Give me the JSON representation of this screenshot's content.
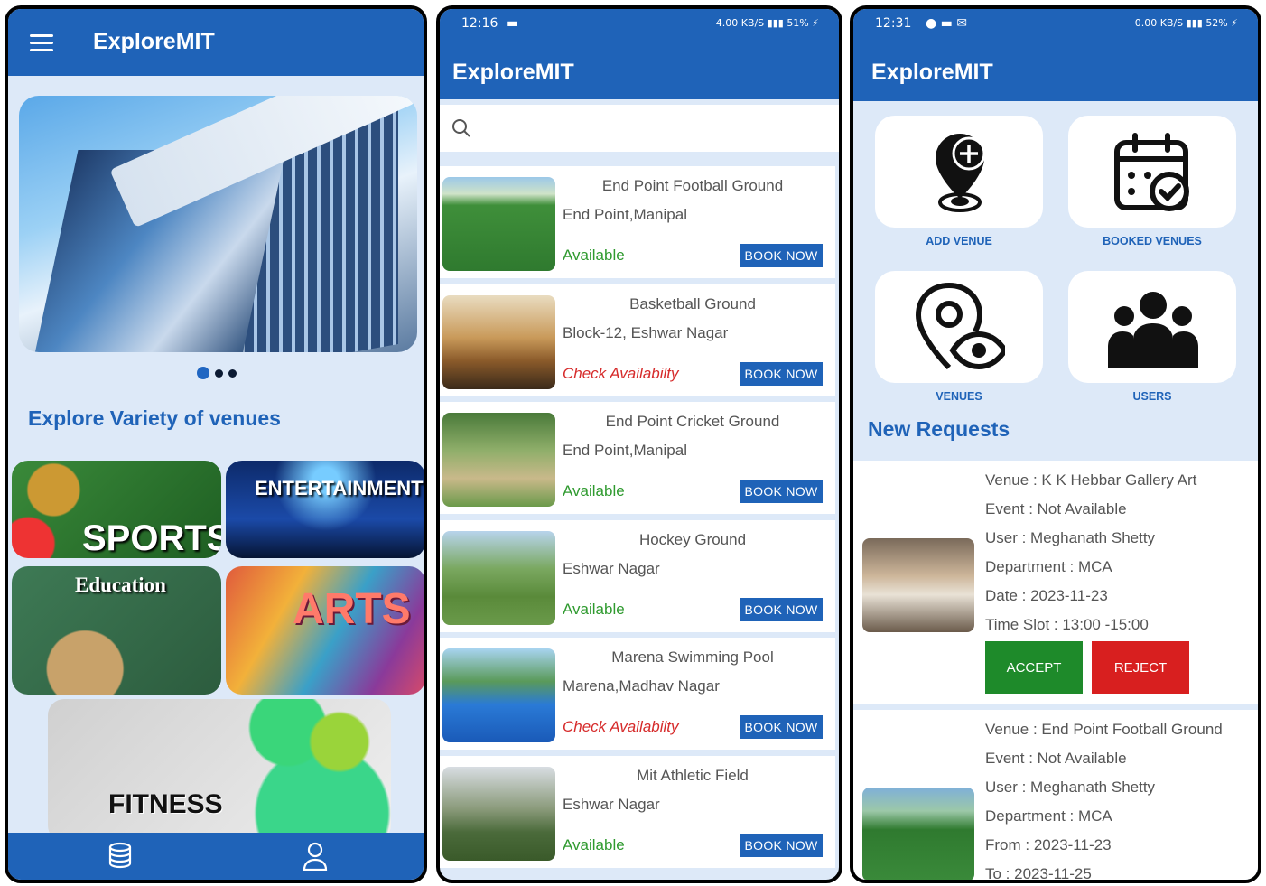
{
  "app_name": "ExploreMIT",
  "screen1": {
    "title": "ExploreMIT",
    "section_title": "Explore Variety of venues",
    "categories": {
      "sports": "SPORTS",
      "entertainment": "ENTERTAINMENT",
      "education": "Education",
      "arts": "ARTS",
      "fitness": "FITNESS"
    },
    "carousel": {
      "pages": 3,
      "active": 1
    },
    "bottom_nav": [
      "database-icon",
      "user-icon"
    ]
  },
  "screen2": {
    "status": {
      "time": "12:16",
      "battery": "51%",
      "net_speed": "4.00\nKB/S"
    },
    "title": "ExploreMIT",
    "search": {
      "value": "",
      "placeholder": ""
    },
    "book_label": "BOOK NOW",
    "venues": [
      {
        "name": "End Point Football Ground",
        "location": "End Point,Manipal",
        "status": "Available",
        "status_type": "ok"
      },
      {
        "name": "Basketball Ground",
        "location": "Block-12, Eshwar Nagar",
        "status": "Check Availabilty",
        "status_type": "check"
      },
      {
        "name": "End Point Cricket Ground",
        "location": "End Point,Manipal",
        "status": "Available",
        "status_type": "ok"
      },
      {
        "name": "Hockey Ground",
        "location": "Eshwar Nagar",
        "status": "Available",
        "status_type": "ok"
      },
      {
        "name": "Marena Swimming Pool",
        "location": "Marena,Madhav Nagar",
        "status": "Check Availabilty",
        "status_type": "check"
      },
      {
        "name": "Mit Athletic Field",
        "location": " Eshwar Nagar",
        "status": "Available",
        "status_type": "ok"
      }
    ]
  },
  "screen3": {
    "status": {
      "time": "12:31",
      "battery": "52%",
      "net_speed": "0.00\nKB/S"
    },
    "title": "ExploreMIT",
    "tiles": {
      "add_venue": "ADD VENUE",
      "booked_venues": "BOOKED VENUES",
      "venues": "VENUES",
      "users": "USERS"
    },
    "new_requests_title": "New Requests",
    "accept_label": "ACCEPT",
    "reject_label": "REJECT",
    "requests": [
      {
        "venue": "Venue : K K Hebbar Gallery Art",
        "event": "Event : Not Available",
        "user": "User : Meghanath Shetty",
        "department": "Department : MCA",
        "date": "Date : 2023-11-23",
        "slot": "Time Slot : 13:00 -15:00"
      },
      {
        "venue": "Venue :  End Point Football Ground",
        "event": "Event : Not Available",
        "user": "User : Meghanath Shetty",
        "department": "Department : MCA",
        "from": "From : 2023-11-23",
        "to": "To : 2023-11-25"
      }
    ]
  },
  "colors": {
    "primary": "#1f63b8",
    "background": "#dde9f8",
    "available": "#2f9a2f",
    "check": "#d62b2b",
    "accept": "#1e8a2a",
    "reject": "#d81f1f"
  }
}
